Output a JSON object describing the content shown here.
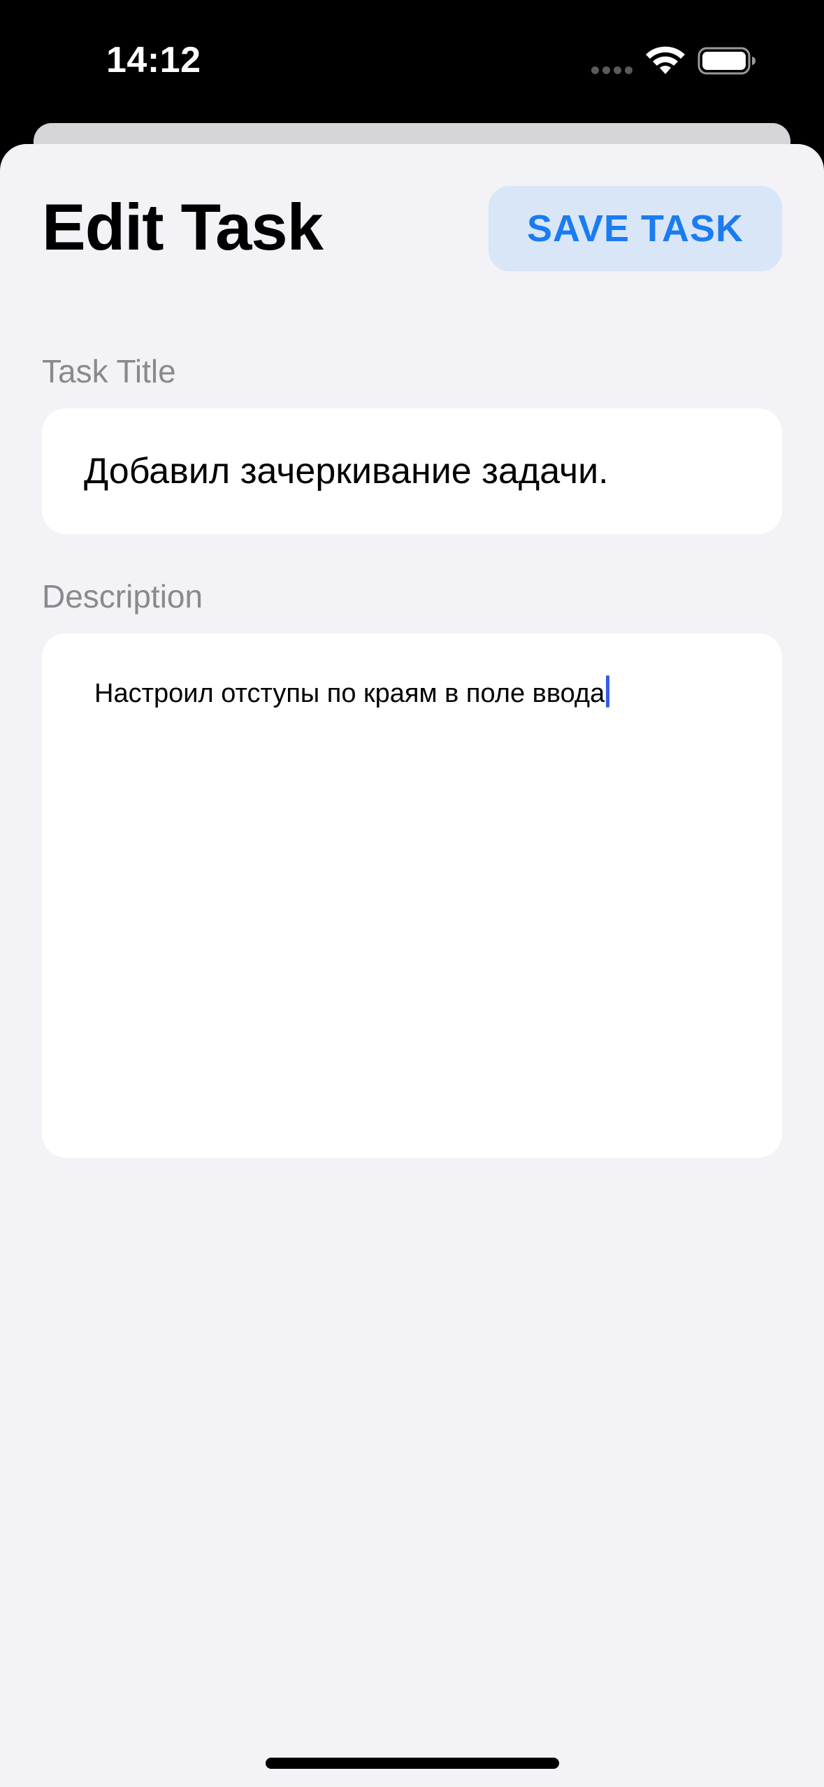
{
  "status_bar": {
    "time": "14:12",
    "icons": [
      "signal-dots-icon",
      "wifi-icon",
      "battery-icon"
    ]
  },
  "header": {
    "title": "Edit Task",
    "save_label": "SAVE TASK"
  },
  "form": {
    "title_label": "Task Title",
    "title_value": "Добавил зачеркивание задачи.",
    "description_label": "Description",
    "description_value": "Настроил отступы по краям в поле ввода"
  },
  "colors": {
    "accent": "#1a7cf0",
    "button_bg": "#d9e6f8",
    "sheet_bg": "#f2f2f7",
    "label": "#8a8a8e",
    "cursor": "#3a5be6"
  }
}
